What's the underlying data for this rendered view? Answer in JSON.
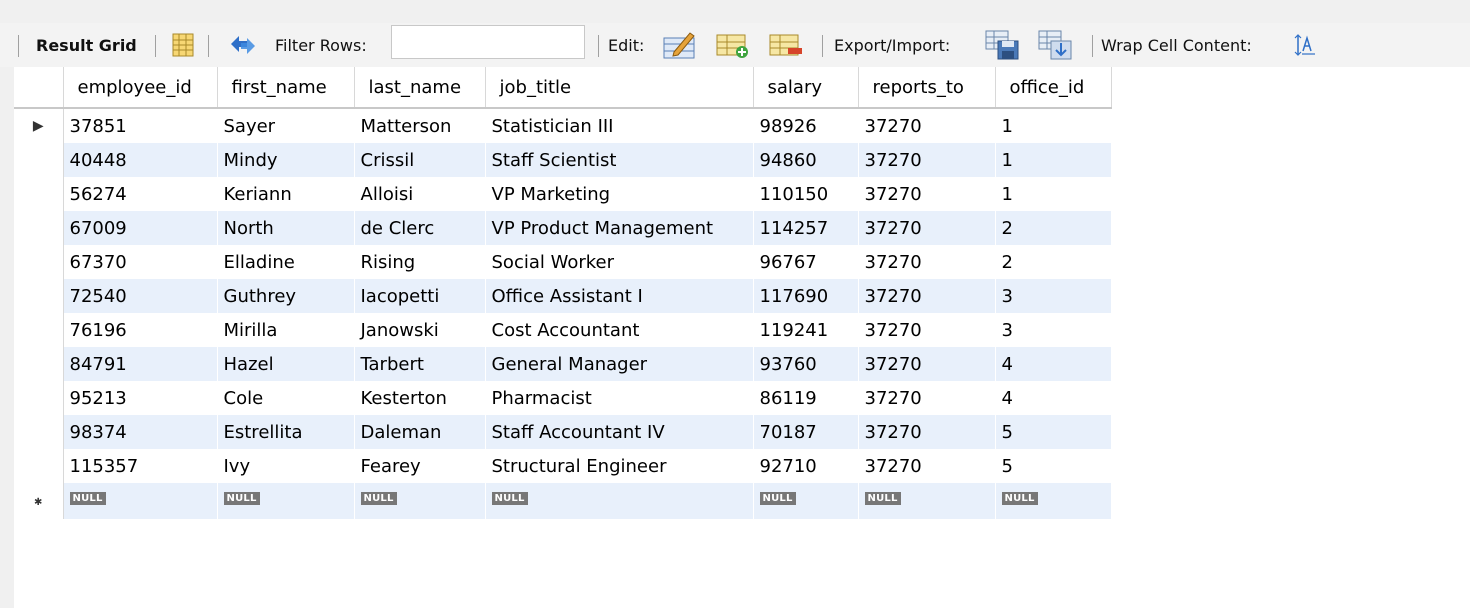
{
  "toolbar": {
    "result_grid": "Result Grid",
    "filter_rows": "Filter Rows:",
    "filter_value": "",
    "edit": "Edit:",
    "export_import": "Export/Import:",
    "wrap_cell": "Wrap Cell Content:"
  },
  "grid": {
    "columns": [
      "employee_id",
      "first_name",
      "last_name",
      "job_title",
      "salary",
      "reports_to",
      "office_id"
    ],
    "rows": [
      [
        "37851",
        "Sayer",
        "Matterson",
        "Statistician III",
        "98926",
        "37270",
        "1"
      ],
      [
        "40448",
        "Mindy",
        "Crissil",
        "Staff Scientist",
        "94860",
        "37270",
        "1"
      ],
      [
        "56274",
        "Keriann",
        "Alloisi",
        "VP Marketing",
        "110150",
        "37270",
        "1"
      ],
      [
        "67009",
        "North",
        "de Clerc",
        "VP Product Management",
        "114257",
        "37270",
        "2"
      ],
      [
        "67370",
        "Elladine",
        "Rising",
        "Social Worker",
        "96767",
        "37270",
        "2"
      ],
      [
        "72540",
        "Guthrey",
        "Iacopetti",
        "Office Assistant I",
        "117690",
        "37270",
        "3"
      ],
      [
        "76196",
        "Mirilla",
        "Janowski",
        "Cost Accountant",
        "119241",
        "37270",
        "3"
      ],
      [
        "84791",
        "Hazel",
        "Tarbert",
        "General Manager",
        "93760",
        "37270",
        "4"
      ],
      [
        "95213",
        "Cole",
        "Kesterton",
        "Pharmacist",
        "86119",
        "37270",
        "4"
      ],
      [
        "98374",
        "Estrellita",
        "Daleman",
        "Staff Accountant IV",
        "70187",
        "37270",
        "5"
      ],
      [
        "115357",
        "Ivy",
        "Fearey",
        "Structural Engineer",
        "92710",
        "37270",
        "5"
      ]
    ],
    "null_label": "NULL",
    "current_row_marker": "▶",
    "new_row_marker": "✱"
  },
  "icons": [
    "result-grid-icon",
    "refresh-icon",
    "edit-row-icon",
    "insert-row-icon",
    "delete-row-icon",
    "export-icon",
    "import-icon",
    "wrap-text-icon"
  ]
}
